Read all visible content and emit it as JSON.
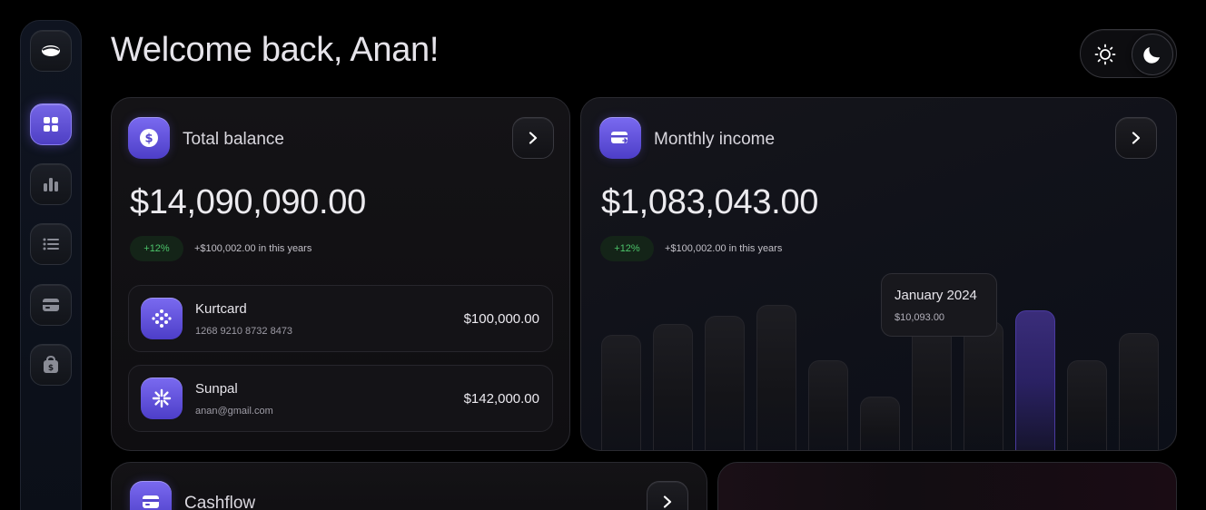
{
  "header": {
    "welcome": "Welcome back, Anan!"
  },
  "theme_toggle": {
    "options": [
      "sun-icon",
      "moon-icon"
    ],
    "selected": "dark"
  },
  "sidebar": {
    "items": [
      {
        "icon": "logo-icon"
      },
      {
        "icon": "grid-icon",
        "active": true
      },
      {
        "icon": "bar-chart-icon"
      },
      {
        "icon": "list-icon"
      },
      {
        "icon": "card-icon"
      },
      {
        "icon": "wallet-icon"
      }
    ]
  },
  "balance": {
    "title": "Total balance",
    "amount": "$14,090,090.00",
    "growth": "+12%",
    "growth_note": "+$100,002.00 in this years",
    "accounts": [
      {
        "name": "Kurtcard",
        "sub": "1268 9210 8732 8473",
        "amount": "$100,000.00"
      },
      {
        "name": "Sunpal",
        "sub": "anan@gmail.com",
        "amount": "$142,000.00"
      }
    ]
  },
  "income": {
    "title": "Monthly income",
    "amount": "$1,083,043.00",
    "growth": "+12%",
    "growth_note": "+$100,002.00 in this years",
    "tooltip": {
      "month": "January 2024",
      "value": "$10,093.00"
    }
  },
  "chart_data": {
    "type": "bar",
    "values": [
      0.68,
      0.74,
      0.79,
      0.85,
      0.53,
      0.32,
      0.75,
      0.76,
      0.82,
      0.53,
      0.69
    ],
    "highlight_index": 8,
    "colors": {
      "bar": "#1d1d22",
      "highlight": "#3a2d7a"
    }
  },
  "cashflow": {
    "title": "Cashflow"
  },
  "colors": {
    "accent": "#6a5ae0",
    "positive": "#4cc46a",
    "background": "#000000"
  }
}
